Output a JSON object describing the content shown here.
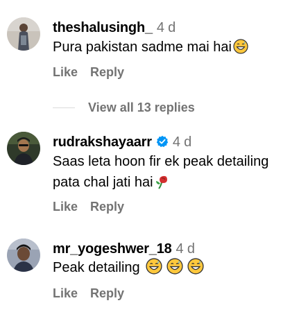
{
  "comments": [
    {
      "username": "theshalusingh_",
      "time": "4 d",
      "text": "Pura pakistan sadme mai hai",
      "emojis": [
        "grinning-sweat-emoji"
      ],
      "verified": false,
      "like_label": "Like",
      "reply_label": "Reply"
    },
    {
      "username": "rudrakshayaarr",
      "time": "4 d",
      "text": "Saas leta hoon fir ek peak detailing pata chal jati hai",
      "emojis": [
        "rose-emoji"
      ],
      "verified": true,
      "like_label": "Like",
      "reply_label": "Reply"
    },
    {
      "username": "mr_yogeshwer_18",
      "time": "4 d",
      "text": "Peak detailing",
      "emojis": [
        "grinning-sweat-emoji",
        "grinning-sweat-emoji",
        "grinning-sweat-emoji"
      ],
      "verified": false,
      "like_label": "Like",
      "reply_label": "Reply"
    }
  ],
  "replies_toggle": {
    "label": "View all 13 replies"
  },
  "colors": {
    "secondary_text": "#737373",
    "verified_blue": "#0095f6",
    "divider": "#dbdbdb"
  }
}
